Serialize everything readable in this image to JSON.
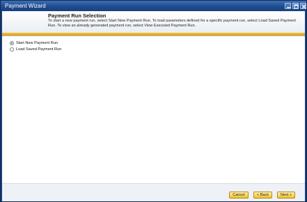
{
  "window": {
    "title": "Payment Wizard"
  },
  "header": {
    "title": "Payment Run Selection",
    "description": "To start a new payment run, select Start New Payment Run. To load parameters defined for a specific payment run, select Load Saved Payment Run. To view an already generated payment run, select View Executed Payment Run."
  },
  "options": [
    {
      "label": "Start New Payment Run",
      "selected": true
    },
    {
      "label": "Load Saved Payment Run",
      "selected": false
    }
  ],
  "footer": {
    "cancel_label": "Cancel",
    "back_label": "< Back",
    "next_label": "Next >"
  },
  "colors": {
    "titlebar": "#1f4d91",
    "accent": "#f0b020",
    "button": "#f7d45a"
  },
  "icons": {
    "minimize": "minimize-icon",
    "maximize": "maximize-icon",
    "close": "close-icon"
  }
}
